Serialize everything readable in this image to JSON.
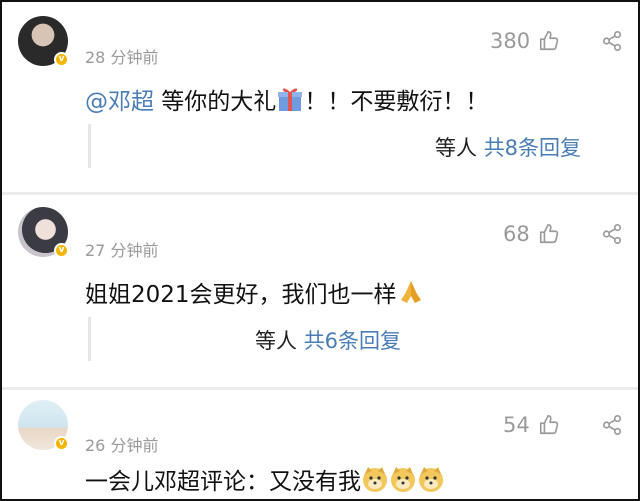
{
  "comments": [
    {
      "time": "28 分钟前",
      "likes": "380",
      "mention": "@邓超",
      "text": " 等你的大礼",
      "text_after_emoji": "！！不要敷衍！！",
      "emoji": "gift",
      "reply_prefix": "等人",
      "reply_link": "共8条回复"
    },
    {
      "time": "27 分钟前",
      "likes": "68",
      "text": "姐姐2021会更好，我们也一样",
      "emoji": "praying-hands",
      "reply_prefix": "等人",
      "reply_link": "共6条回复"
    },
    {
      "time": "26 分钟前",
      "likes": "54",
      "text": "一会儿邓超评论：又没有我",
      "emoji": "doge"
    }
  ],
  "colors": {
    "link": "#4a7db5",
    "muted": "#9a9a9a",
    "badge": "#f5b400"
  }
}
